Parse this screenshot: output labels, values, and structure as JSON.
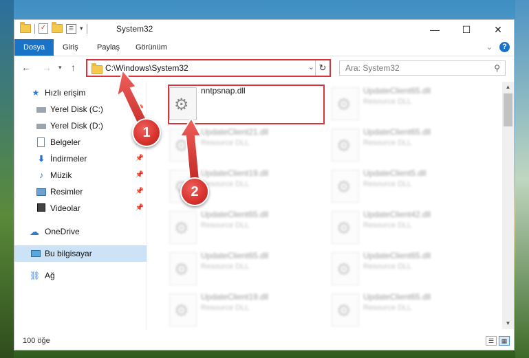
{
  "window": {
    "title": "System32",
    "controls": {
      "minimize": "—",
      "maximize": "☐",
      "close": "✕"
    }
  },
  "ribbon": {
    "tabs": [
      "Dosya",
      "Giriş",
      "Paylaş",
      "Görünüm"
    ]
  },
  "navbar": {
    "address": "C:\\Windows\\System32",
    "search_placeholder": "Ara: System32"
  },
  "sidebar": {
    "items": [
      {
        "label": "Hızlı erişim",
        "icon": "star-icon"
      },
      {
        "label": "Yerel Disk (C:)",
        "icon": "drive-icon",
        "pinned": true
      },
      {
        "label": "Yerel Disk (D:)",
        "icon": "drive-icon",
        "pinned": true
      },
      {
        "label": "Belgeler",
        "icon": "document-icon",
        "pinned": true
      },
      {
        "label": "İndirmeler",
        "icon": "download-icon",
        "pinned": true
      },
      {
        "label": "Müzik",
        "icon": "music-icon",
        "pinned": true
      },
      {
        "label": "Resimler",
        "icon": "picture-icon",
        "pinned": true
      },
      {
        "label": "Videolar",
        "icon": "video-icon",
        "pinned": true
      },
      {
        "label": "OneDrive",
        "icon": "cloud-icon"
      },
      {
        "label": "Bu bilgisayar",
        "icon": "computer-icon",
        "selected": true
      },
      {
        "label": "Ağ",
        "icon": "network-icon"
      }
    ]
  },
  "files": [
    {
      "name": "nntpsnap.dll",
      "type": "",
      "highlighted": true
    },
    {
      "name": "UpdateClient65.dll",
      "type": "Resource DLL"
    },
    {
      "name": "UpdateClient21.dll",
      "type": "Resource DLL"
    },
    {
      "name": "UpdateClient65.dll",
      "type": "Resource DLL"
    },
    {
      "name": "UpdateClient19.dll",
      "type": "Resource DLL"
    },
    {
      "name": "UpdateClient5.dll",
      "type": "Resource DLL"
    },
    {
      "name": "UpdateClient65.dll",
      "type": "Resource DLL"
    },
    {
      "name": "UpdateClient42.dll",
      "type": "Resource DLL"
    },
    {
      "name": "UpdateClient65.dll",
      "type": "Resource DLL"
    },
    {
      "name": "UpdateClient65.dll",
      "type": "Resource DLL"
    },
    {
      "name": "UpdateClient19.dll",
      "type": "Resource DLL"
    },
    {
      "name": "UpdateClient65.dll",
      "type": "Resource DLL"
    }
  ],
  "status": {
    "item_count": "100 öğe"
  },
  "annotations": {
    "marker1": "1",
    "marker2": "2"
  },
  "colors": {
    "accent": "#1a73c7",
    "highlight": "#d9343b",
    "selection": "#cce3f7"
  }
}
